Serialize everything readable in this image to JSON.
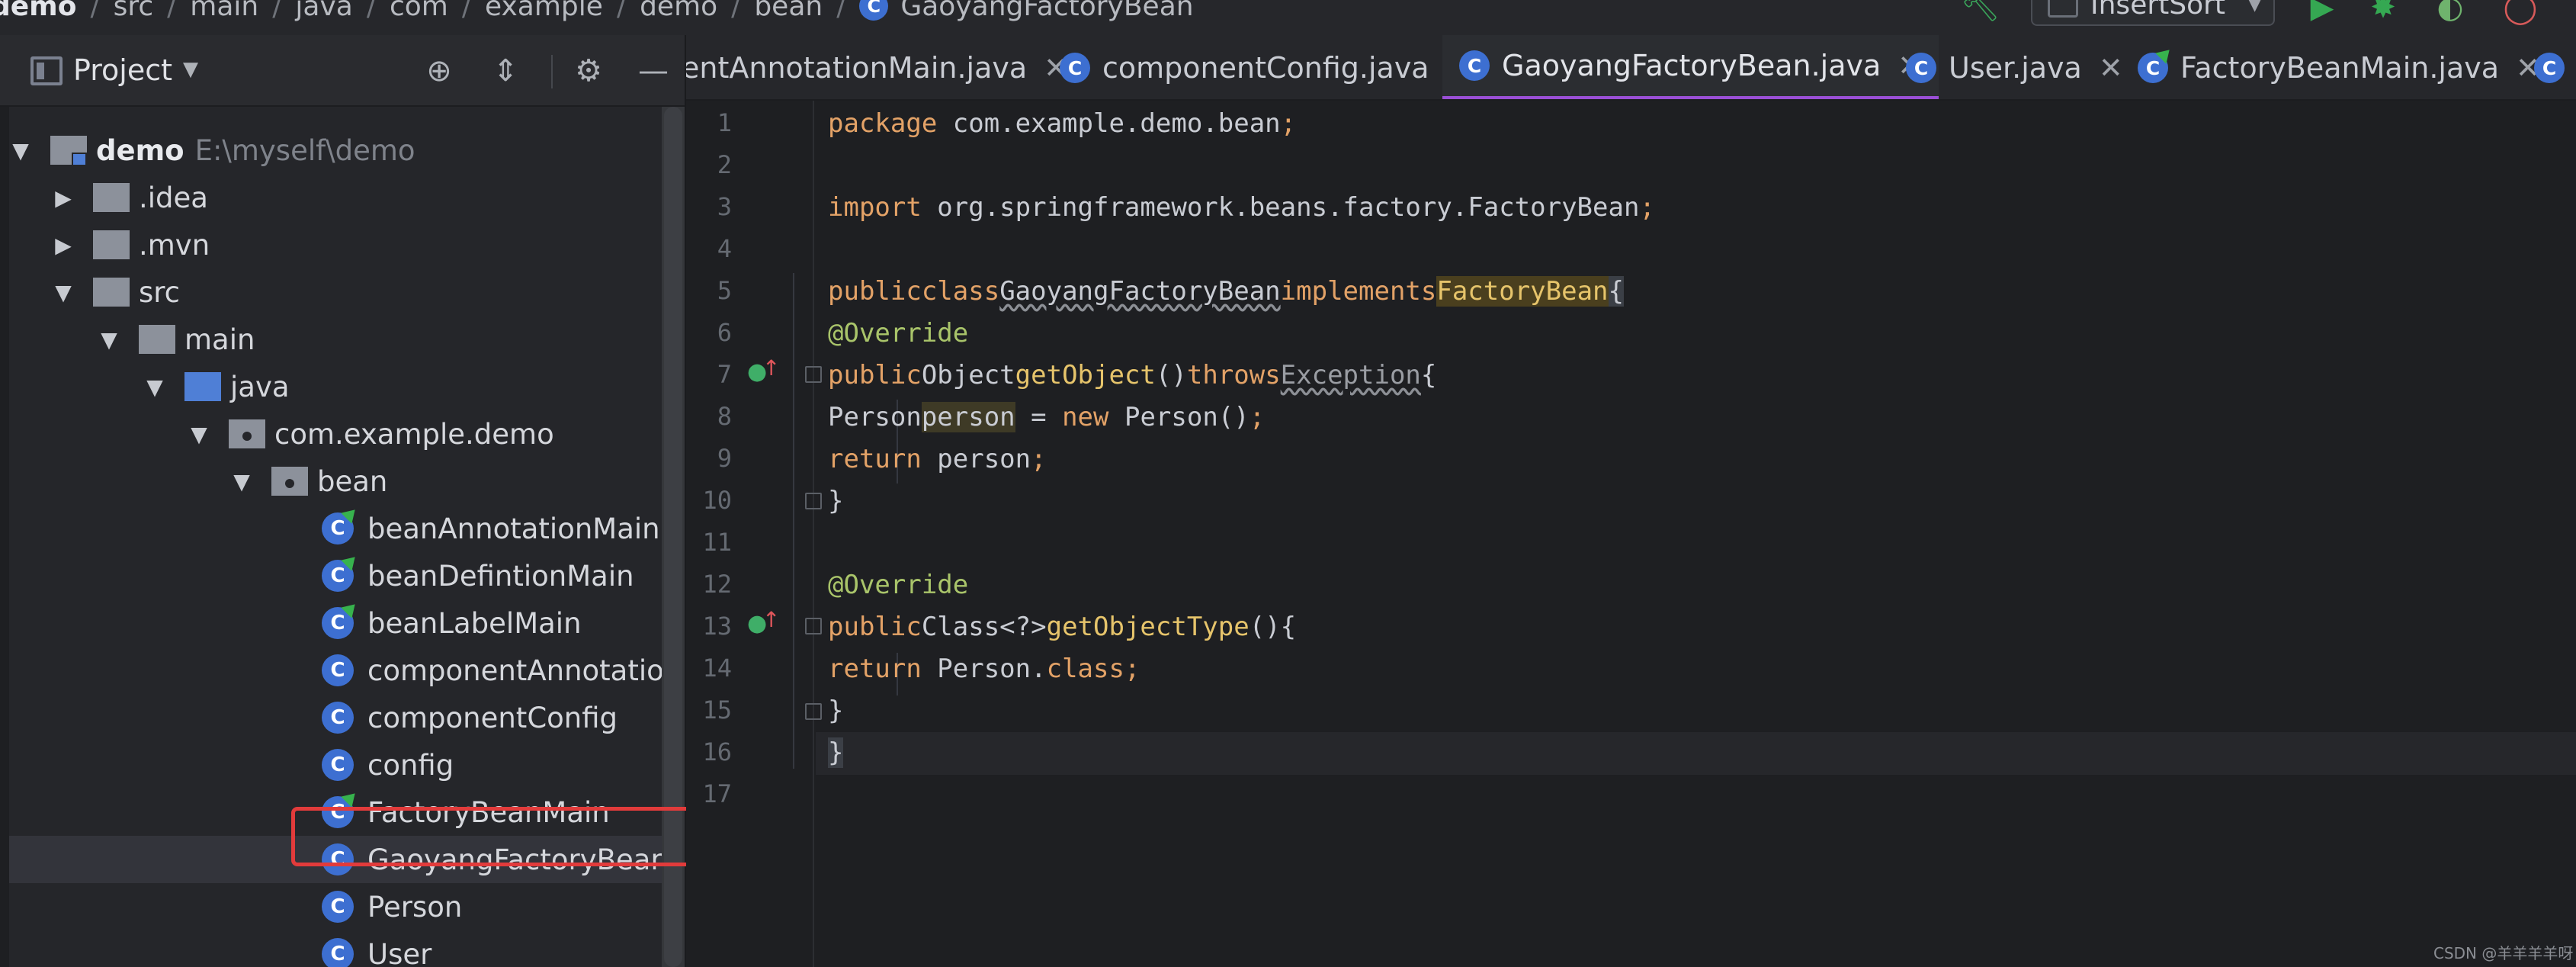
{
  "breadcrumbs": [
    "demo",
    "src",
    "main",
    "java",
    "com",
    "example",
    "demo",
    "bean",
    "GaoyangFactoryBean"
  ],
  "toolbar": {
    "run_config": "InsertSort"
  },
  "project_panel": {
    "title": "Project",
    "tree": [
      {
        "name": "demo",
        "path": "E:\\myself\\demo",
        "expanded": true
      },
      {
        "name": ".idea",
        "expanded": false
      },
      {
        "name": ".mvn",
        "expanded": false
      },
      {
        "name": "src",
        "expanded": true
      },
      {
        "name": "main",
        "expanded": true
      },
      {
        "name": "java",
        "expanded": true
      },
      {
        "name": "com.example.demo",
        "expanded": true
      },
      {
        "name": "bean",
        "expanded": true
      },
      {
        "name": "beanAnnotationMain"
      },
      {
        "name": "beanDefintionMain"
      },
      {
        "name": "beanLabelMain"
      },
      {
        "name": "componentAnnotationM"
      },
      {
        "name": "componentConfig"
      },
      {
        "name": "config"
      },
      {
        "name": "FactoryBeanMain"
      },
      {
        "name": "GaoyangFactoryBean",
        "selected": true
      },
      {
        "name": "Person"
      },
      {
        "name": "User"
      }
    ]
  },
  "editor": {
    "tabs": [
      {
        "label": "entAnnotationMain.java"
      },
      {
        "label": "componentConfig.java"
      },
      {
        "label": "GaoyangFactoryBean.java",
        "active": true
      },
      {
        "label": "User.java"
      },
      {
        "label": "FactoryBeanMain.java"
      }
    ],
    "line_numbers": [
      "1",
      "2",
      "3",
      "4",
      "5",
      "6",
      "7",
      "8",
      "9",
      "10",
      "11",
      "12",
      "13",
      "14",
      "15",
      "16",
      "17"
    ],
    "code": {
      "l1_kw": "package",
      "l1_rest": " com.example.demo.bean",
      "l1_semi": ";",
      "l3_kw": "import",
      "l3_rest": " org.springframework.beans.factory.FactoryBean",
      "l3_semi": ";",
      "l5_kw1": "public",
      "l5_kw2": "class",
      "l5_name": "GaoyangFactoryBean",
      "l5_kw3": "implements",
      "l5_iface": "FactoryBean",
      "l5_brace": "{",
      "l6_ann": "@Override",
      "l7_kw1": "public",
      "l7_type": "Object",
      "l7_fn": "getObject",
      "l7_parens": "()",
      "l7_kw2": "throws",
      "l7_exc": "Exception",
      "l7_brace": "{",
      "l8_type": "Person",
      "l8_var": "person",
      "l8_eq": " = ",
      "l8_kw": "new",
      "l8_rest": " Person()",
      "l8_semi": ";",
      "l9_kw": "return",
      "l9_rest": " person",
      "l9_semi": ";",
      "l10": "}",
      "l12_ann": "@Override",
      "l13_kw1": "public",
      "l13_type": "Class<?>",
      "l13_fn": "getObjectType",
      "l13_parens": "()",
      "l13_brace": "{",
      "l14_kw": "return",
      "l14_rest": " Person.",
      "l14_kw2": "class",
      "l14_semi": ";",
      "l15": "}",
      "l16": "}"
    }
  },
  "watermark": "CSDN @羊羊羊羊呀",
  "colors": {
    "keyword": "#e3a267",
    "annotation": "#a9c46a",
    "method": "#e6c46b",
    "selection_box": "#e23b3b",
    "active_tab": "#9a4fd6",
    "class_icon": "#3d6fd1"
  }
}
